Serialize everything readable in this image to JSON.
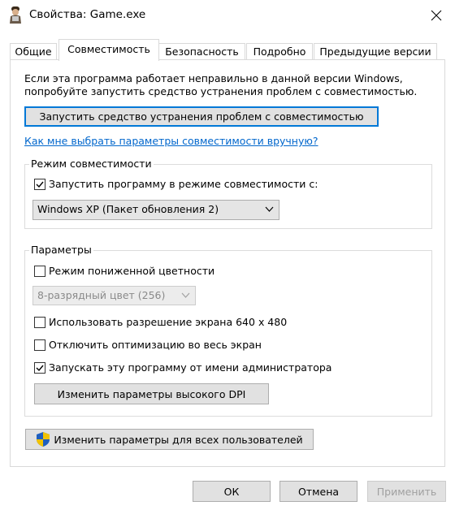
{
  "window": {
    "title": "Свойства: Game.exe"
  },
  "tabs": [
    {
      "label": "Общие"
    },
    {
      "label": "Совместимость"
    },
    {
      "label": "Безопасность"
    },
    {
      "label": "Подробно"
    },
    {
      "label": "Предыдущие версии"
    }
  ],
  "compat": {
    "intro_line1": "Если эта программа работает неправильно в данной версии Windows,",
    "intro_line2": "попробуйте запустить средство устранения проблем с совместимостью.",
    "troubleshooter_button": "Запустить средство устранения проблем с совместимостью",
    "manual_link": "Как мне выбрать параметры совместимости вручную?",
    "mode_group": {
      "label": "Режим совместимости",
      "checkbox_label": "Запустить программу в режиме совместимости с:",
      "checked": true,
      "selected_os": "Windows XP (Пакет обновления 2)"
    },
    "settings_group": {
      "label": "Параметры",
      "reduced_color": {
        "label": "Режим пониженной цветности",
        "checked": false
      },
      "color_select": "8-разрядный цвет (256)",
      "res_640": {
        "label": "Использовать разрешение экрана 640 x 480",
        "checked": false
      },
      "disable_fullscreen_opt": {
        "label": "Отключить оптимизацию во весь экран",
        "checked": false
      },
      "run_as_admin": {
        "label": "Запускать эту программу от имени администратора",
        "checked": true
      },
      "dpi_button": "Изменить параметры высокого DPI"
    },
    "all_users_button": "Изменить параметры для всех пользователей"
  },
  "footer": {
    "ok": "ОК",
    "cancel": "Отмена",
    "apply": "Применить"
  }
}
